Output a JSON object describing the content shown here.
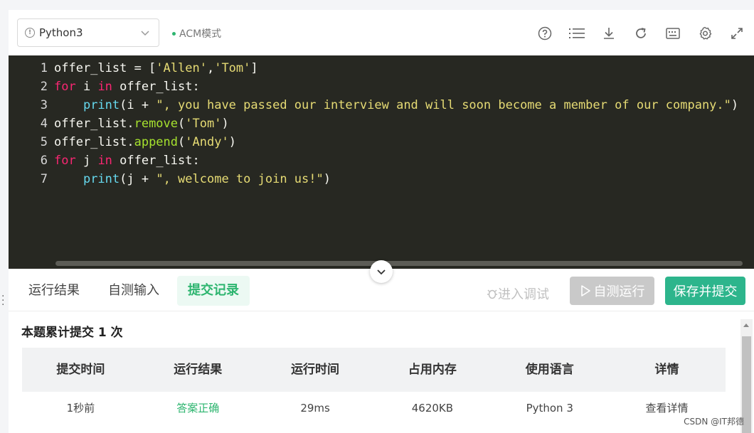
{
  "toolbar": {
    "language": "Python3",
    "mode": "ACM模式",
    "icons": [
      "help-icon",
      "list-icon",
      "download-icon",
      "refresh-icon",
      "keyboard-icon",
      "settings-icon",
      "fullscreen-icon"
    ]
  },
  "editor": {
    "lines": [
      {
        "num": "1"
      },
      {
        "num": "2"
      },
      {
        "num": "3"
      },
      {
        "num": "4"
      },
      {
        "num": "5"
      },
      {
        "num": "6"
      },
      {
        "num": "7"
      }
    ],
    "tokens": {
      "l1_a": "offer_list = [",
      "l1_s1": "'Allen'",
      "l1_c": ",",
      "l1_s2": "'Tom'",
      "l1_e": "]",
      "l2_for": "for",
      "l2_i": " i ",
      "l2_in": "in",
      "l2_rest": " offer_list:",
      "l3_indent": "    ",
      "l3_print": "print",
      "l3_a": "(i + ",
      "l3_str": "\", you have passed our interview and will soon become a member of our company.\"",
      "l3_e": ")",
      "l4_a": "offer_list.",
      "l4_m": "remove",
      "l4_b": "(",
      "l4_s": "'Tom'",
      "l4_e": ")",
      "l5_a": "offer_list.",
      "l5_m": "append",
      "l5_b": "(",
      "l5_s": "'Andy'",
      "l5_e": ")",
      "l6_for": "for",
      "l6_j": " j ",
      "l6_in": "in",
      "l6_rest": " offer_list:",
      "l7_indent": "    ",
      "l7_print": "print",
      "l7_a": "(j + ",
      "l7_str": "\", welcome to join us!\"",
      "l7_e": ")"
    }
  },
  "tabs": {
    "run_result": "运行结果",
    "self_input": "自测输入",
    "submit_records": "提交记录"
  },
  "actions": {
    "debug": "进入调试",
    "self_run": "自测运行",
    "save_submit": "保存并提交"
  },
  "result": {
    "summary": "本题累计提交 1 次",
    "columns": [
      "提交时间",
      "运行结果",
      "运行时间",
      "占用内存",
      "使用语言",
      "详情"
    ],
    "rows": [
      [
        "1秒前",
        "答案正确",
        "29ms",
        "4620KB",
        "Python 3",
        "查看详情"
      ]
    ]
  },
  "watermark": "CSDN @IT邦德",
  "colors": {
    "accent": "#2db56f",
    "submit_button": "#2db58c",
    "editor_bg": "#272822"
  }
}
